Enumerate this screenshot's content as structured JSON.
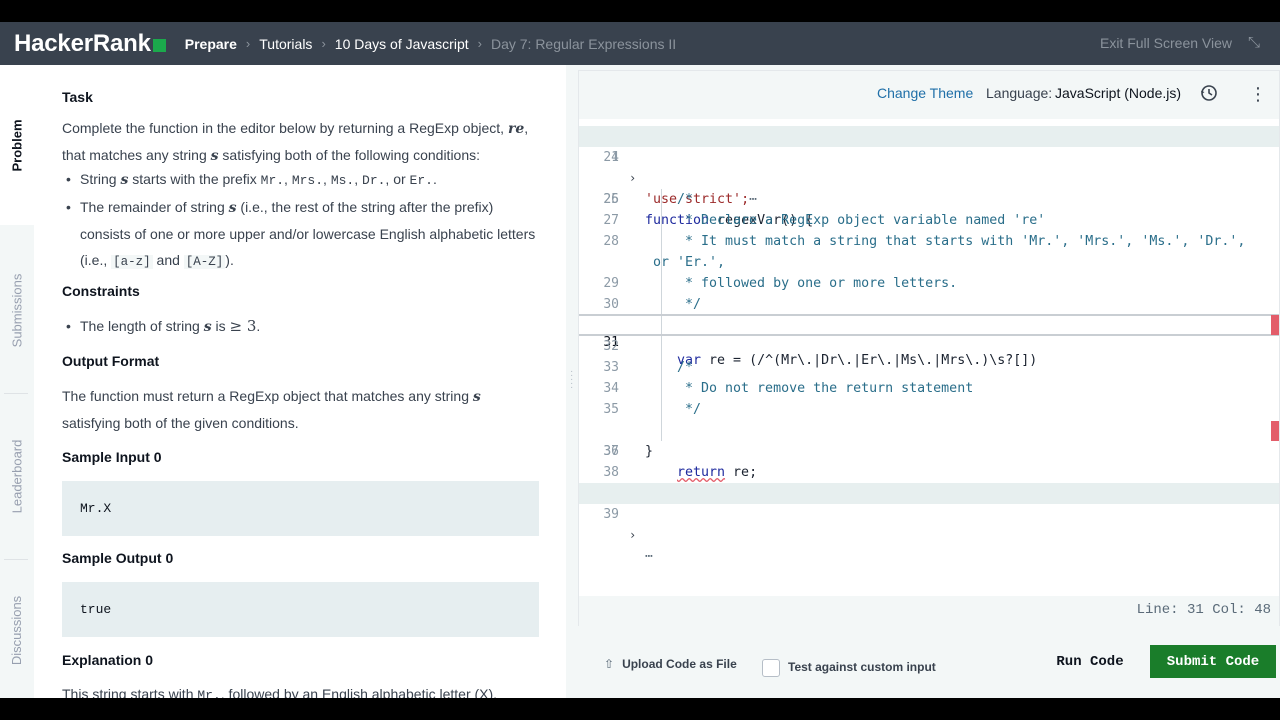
{
  "header": {
    "logo_text": "HackerRank",
    "breadcrumbs": [
      "Prepare",
      "Tutorials",
      "10 Days of Javascript",
      "Day 7: Regular Expressions II"
    ],
    "breadcrumb_separator": "›",
    "exit_fullscreen": "Exit Full Screen View",
    "exit_icon": "⤡"
  },
  "vtabs": [
    "Problem",
    "Submissions",
    "Leaderboard",
    "Discussions"
  ],
  "problem": {
    "task_heading": "Task",
    "task_p1": "Complete the function in the editor below by returning a RegExp object, ",
    "task_p1_var": "re",
    "task_p1_end": ",",
    "task_p2": "that matches any string ",
    "task_p2_var": "s",
    "task_p2_end": " satisfying both of the following conditions:",
    "bullet1_a": "String ",
    "bullet1_var": "s",
    "bullet1_b": " starts with the prefix ",
    "prefixes": [
      "Mr.",
      "Mrs.",
      "Ms.",
      "Dr.",
      "Er."
    ],
    "bullet1_or": ", or ",
    "bullet1_comma": ", ",
    "bullet1_end": ".",
    "bullet2_a": "The remainder of string ",
    "bullet2_var": "s",
    "bullet2_b": " (i.e., the rest of the string after the prefix) consists of one or more upper and/or lowercase English alphabetic letters (i.e., ",
    "bullet2_code1": "[a-z]",
    "bullet2_and": " and ",
    "bullet2_code2": "[A-Z]",
    "bullet2_end": ").",
    "constraints_heading": "Constraints",
    "constraint_a": "The length of string ",
    "constraint_var": "s",
    "constraint_b": " is ",
    "constraint_math": "≥ 3",
    "constraint_end": ".",
    "output_heading": "Output Format",
    "output_p_a": "The function must return a RegExp object that matches any string ",
    "output_p_var": "s",
    "output_p_b": " satisfying both of the given conditions.",
    "sample_input_heading": "Sample Input 0",
    "sample_input": "Mr.X",
    "sample_output_heading": "Sample Output 0",
    "sample_output": "true",
    "explanation_heading": "Explanation 0",
    "explanation_a": "This string starts with ",
    "explanation_code": "Mr.",
    "explanation_b": ", followed by an English alphabetic letter (X)."
  },
  "editor": {
    "change_theme": "Change Theme",
    "language_label": "Language:",
    "language_value": "JavaScript (Node.js)",
    "history_icon": "history-icon",
    "menu_icon": "⋮",
    "fold_arrow": "›",
    "ellipsis": "⋯",
    "lines": {
      "l1_num": "1",
      "l1": "'use strict';",
      "l24_num": "24",
      "l25_num": "25",
      "l25_kw": "function",
      "l25_rest": " regexVar() {",
      "l26_num": "26",
      "l26": "/*",
      "l27_num": "27",
      "l27": " * Declare a RegExp object variable named 're'",
      "l28_num": "28",
      "l28": " * It must match a string that starts with 'Mr.', 'Mrs.', 'Ms.', 'Dr.',",
      "l28b": " or 'Er.',",
      "l29_num": "29",
      "l29": " * followed by one or more letters.",
      "l30_num": "30",
      "l30": " */",
      "l31_num": "31",
      "l31_kw": "var",
      "l31_rest": " re = (/^(Mr\\.|Dr\\.|Er\\.|Ms\\.|Mrs\\.)\\s?[])",
      "l32_num": "32",
      "l33_num": "33",
      "l33": "/*",
      "l34_num": "34",
      "l34": " * Do not remove the return statement",
      "l35_num": "35",
      "l35": " */",
      "l36_num": "36",
      "l36_kw": "return",
      "l36_rest": " re;",
      "l37_num": "37",
      "l37": "}",
      "l38_num": "38",
      "l39_num": "39"
    },
    "status": "Line: 31 Col: 48"
  },
  "actions": {
    "upload_icon": "⇧",
    "upload_label": "Upload Code as File",
    "custom_input_label": "Test against custom input",
    "run_label": "Run Code",
    "submit_label": "Submit Code"
  },
  "colors": {
    "header_bg": "#39424e",
    "brand_green": "#1ba94c",
    "submit_green": "#1a7d2a",
    "link_blue": "#1f6fa8"
  }
}
